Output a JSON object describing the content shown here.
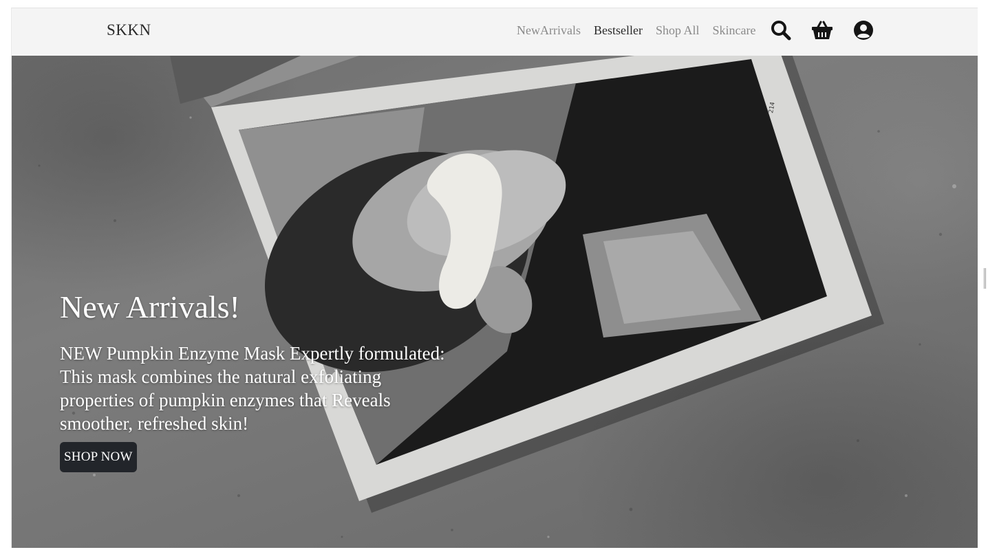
{
  "brand": {
    "name": "SKKN"
  },
  "nav": {
    "links": [
      {
        "label": "NewArrivals",
        "active": false
      },
      {
        "label": "Bestseller",
        "active": true
      },
      {
        "label": "Shop All",
        "active": false
      },
      {
        "label": "Skincare",
        "active": false
      }
    ],
    "icons": [
      "search-icon",
      "basket-icon",
      "account-icon"
    ]
  },
  "hero": {
    "title": "New Arrivals!",
    "description": "NEW Pumpkin Enzyme Mask Expertly formulated: This mask combines the natural exfoliating properties of pumpkin enzymes that Reveals smoother, refreshed skin!",
    "cta_label": "SHOP NOW",
    "page_number": "214"
  },
  "colors": {
    "navbar_bg": "#f4f4f4",
    "text_dark": "#2a2a2a",
    "text_muted": "#8a8a8a",
    "button_bg": "#22252a"
  }
}
